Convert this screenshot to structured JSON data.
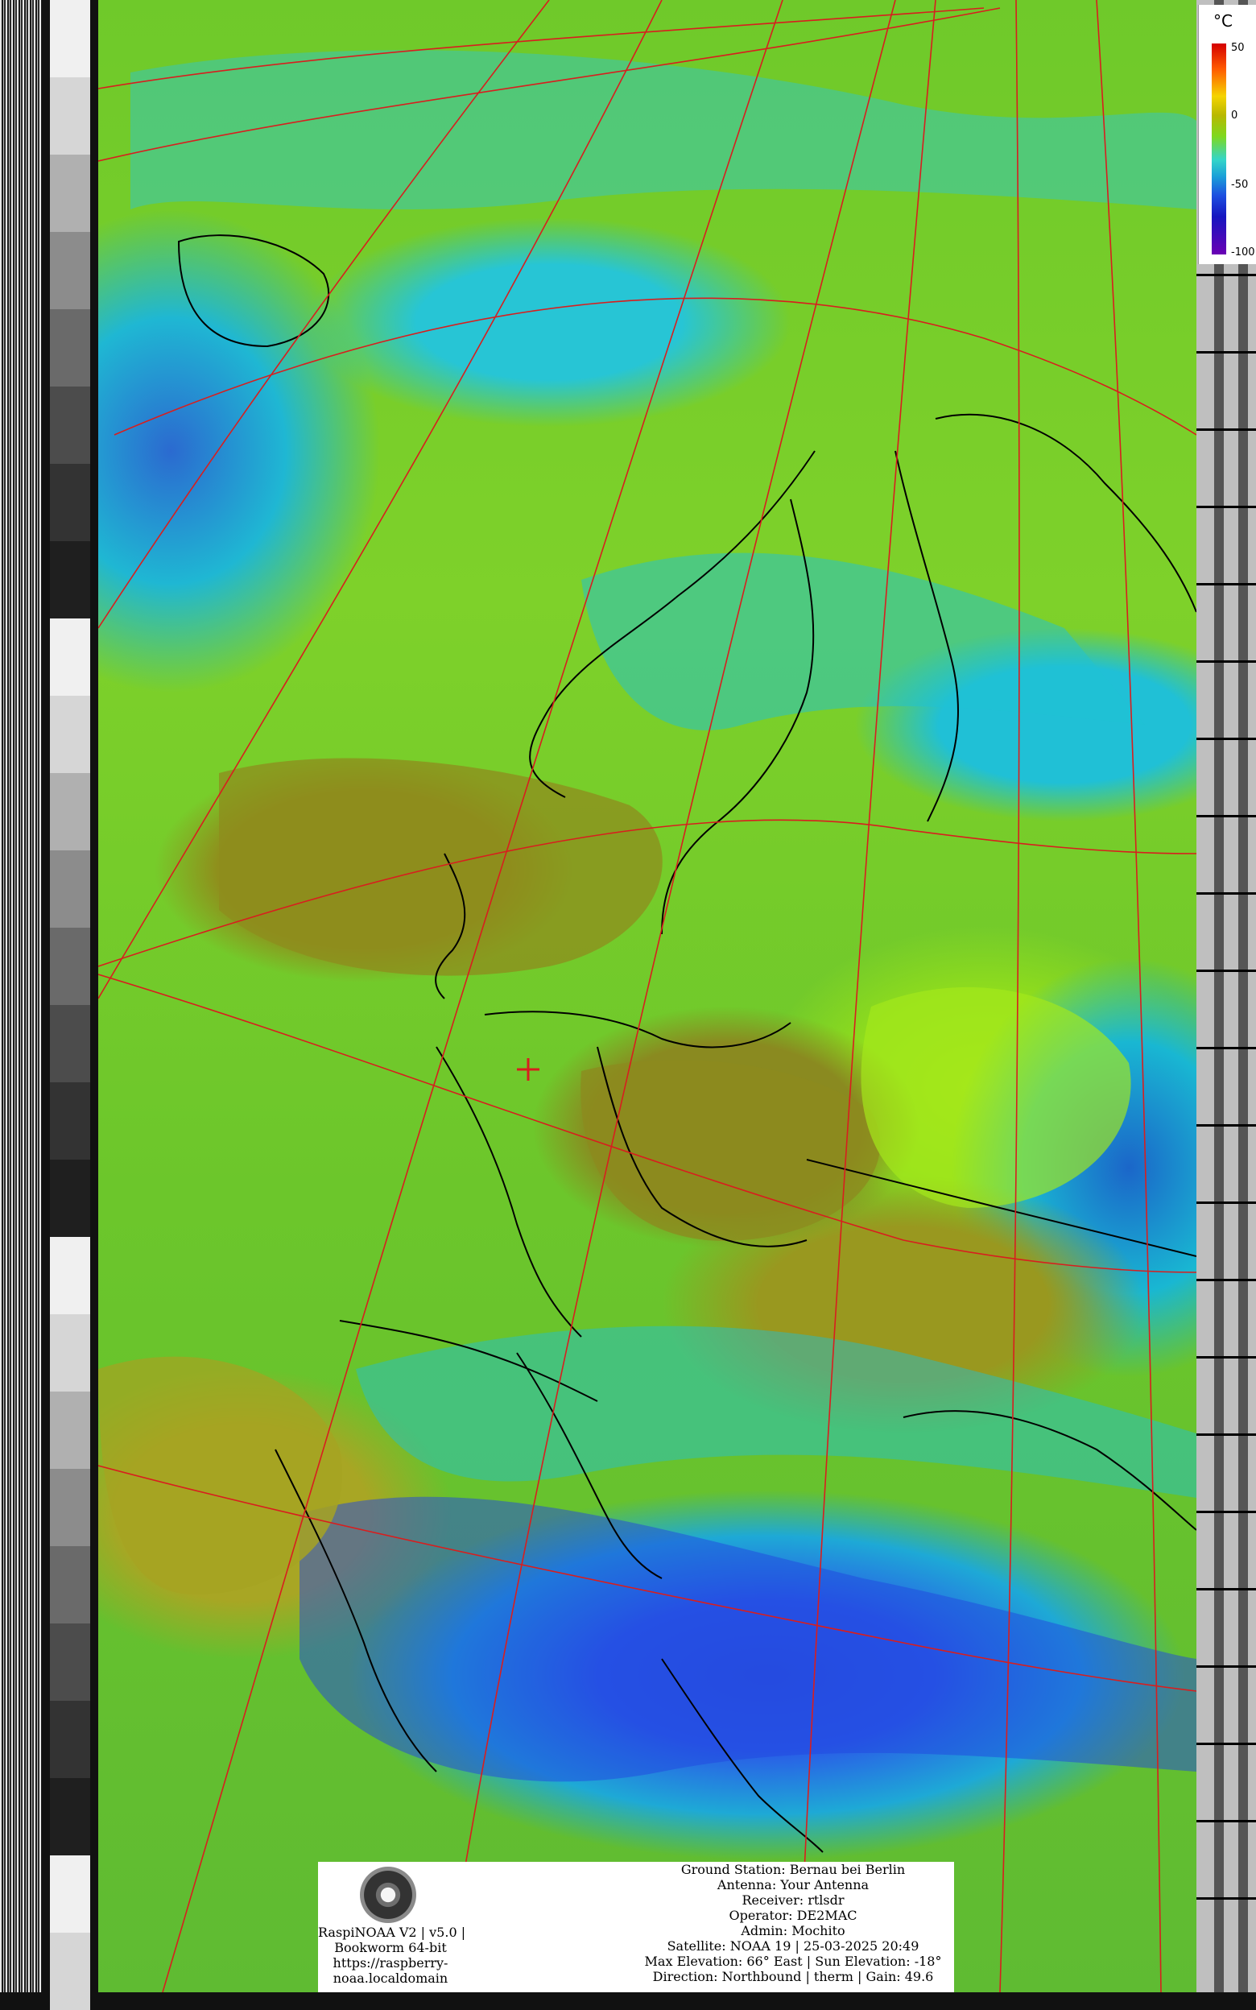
{
  "legend": {
    "unit": "°C",
    "labels": [
      "50",
      "0",
      "-50",
      "-100"
    ],
    "colors": [
      "#d40000",
      "#f5d400",
      "#7fd81e",
      "#34d6c8",
      "#1c4fe0",
      "#6a00b4"
    ]
  },
  "map": {
    "overlay_colors": {
      "borders": "#000000",
      "graticule": "#d81e1e",
      "station_marker": "#d81e1e"
    }
  },
  "info_panel": {
    "logo": "raspinoaa-satellite-dish-logo",
    "left_lines": [
      "RaspiNOAA V2 | v5.0 |",
      "Bookworm 64-bit",
      "https://raspberry-",
      "noaa.localdomain"
    ],
    "right_lines": [
      "Ground Station: Bernau bei Berlin",
      "Antenna: Your Antenna",
      "Receiver: rtlsdr",
      "Operator: DE2MAC",
      "Admin: Mochito",
      "Satellite: NOAA 19 | 25-03-2025 20:49",
      "Max Elevation: 66° East | Sun Elevation: -18°",
      "Direction: Northbound | therm | Gain: 49.6"
    ]
  }
}
